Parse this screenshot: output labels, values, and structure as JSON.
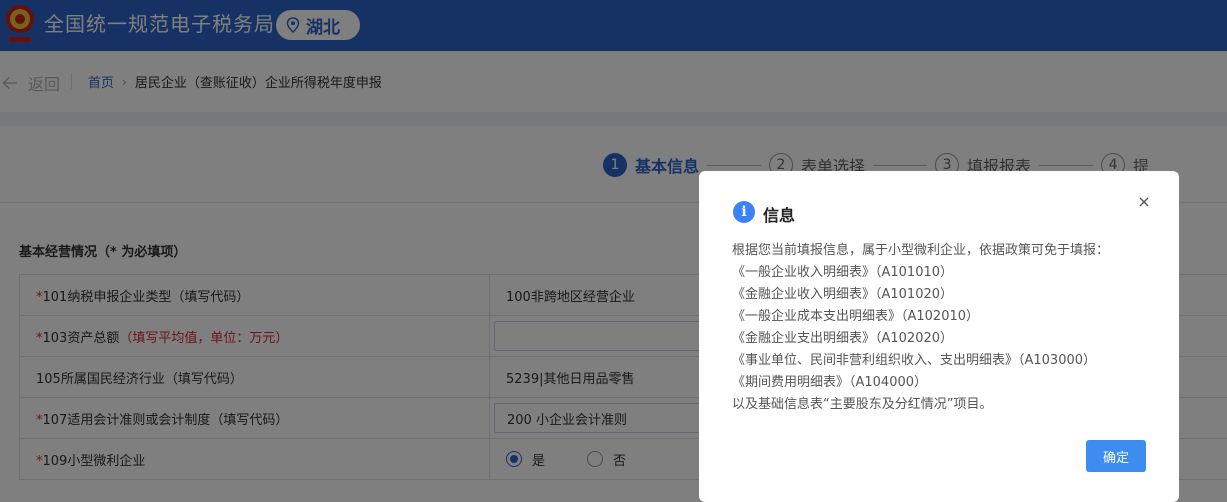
{
  "header": {
    "title": "全国统一规范电子税务局",
    "region": "湖北",
    "brand_color": "#2d64c8"
  },
  "breadcrumb": {
    "back_label": "返回",
    "home": "首页",
    "current": "居民企业（查账征收）企业所得税年度申报"
  },
  "steps": [
    {
      "num": "1",
      "label": "基本信息"
    },
    {
      "num": "2",
      "label": "表单选择"
    },
    {
      "num": "3",
      "label": "填报报表"
    },
    {
      "num": "4",
      "label": "提"
    }
  ],
  "section_title": "基本经营情况（* 为必填项）",
  "form": {
    "rows": [
      {
        "req": "*",
        "label": "101纳税申报企业类型（填写代码）",
        "value": "100非跨地区经营企业"
      },
      {
        "req": "*",
        "label": "103资产总额",
        "hint": "（填写平均值，单位：万元）",
        "value": ""
      },
      {
        "label": "105所属国民经济行业（填写代码）",
        "value": "5239|其他日用品零售"
      },
      {
        "req": "*",
        "label": "107适用会计准则或会计制度（填写代码）",
        "value": "200 小企业会计准则"
      },
      {
        "req": "*",
        "label": "109小型微利企业",
        "options": [
          "是",
          "否"
        ],
        "selected": "是"
      }
    ]
  },
  "dialog": {
    "title": "信息",
    "icon": "info-icon",
    "lines": [
      "根据您当前填报信息，属于小型微利企业，依据政策可免于填报：",
      "《一般企业收入明细表》（A101010）",
      "《金融企业收入明细表》（A101020）",
      "《一般企业成本支出明细表》（A102010）",
      "《金融企业支出明细表》（A102020）",
      "《事业单位、民间非营利组织收入、支出明细表》（A103000）",
      "《期间费用明细表》（A104000）",
      "以及基础信息表“主要股东及分红情况”项目。"
    ],
    "ok_label": "确定"
  }
}
